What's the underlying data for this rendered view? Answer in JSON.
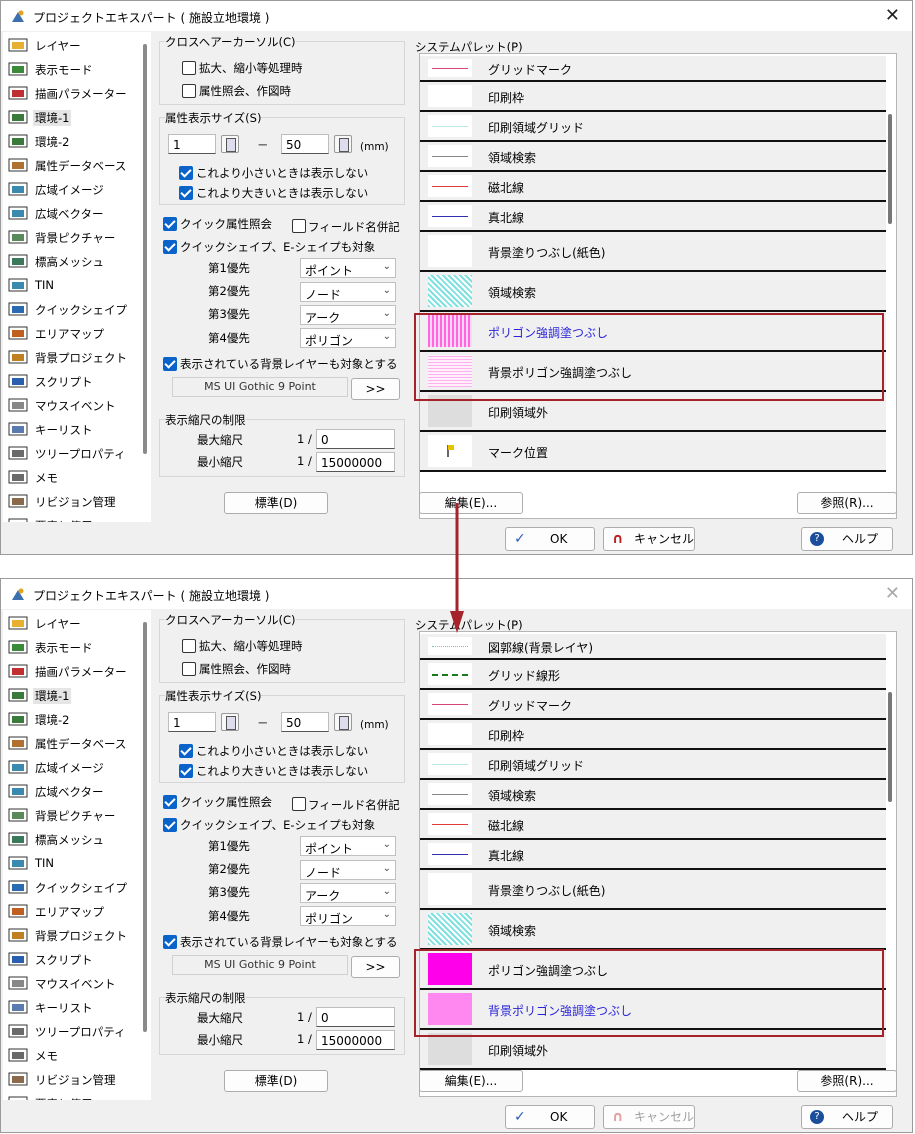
{
  "window": {
    "title": "プロジェクトエキスパート ( 施設立地環境 )",
    "close": "✕"
  },
  "nav_items": [
    "レイヤー",
    "表示モード",
    "描画パラメーター",
    "環境-1",
    "環境-2",
    "属性データベース",
    "広域イメージ",
    "広域ベクター",
    "背景ピクチャー",
    "標高メッシュ",
    "TIN",
    "クイックシェイプ",
    "エリアマップ",
    "背景プロジェクト",
    "スクリプト",
    "マウスイベント",
    "キーリスト",
    "ツリープロパティ",
    "メモ",
    "リビジョン管理",
    "要素と使用"
  ],
  "nav_selected": 3,
  "cross_cursor": {
    "title": "クロスヘアーカーソル(C)",
    "opt1": "拡大、縮小等処理時",
    "opt2": "属性照会、作図時"
  },
  "attr_size": {
    "title": "属性表示サイズ(S)",
    "min": "1",
    "dash": "－",
    "max": "50",
    "unit": "(mm)",
    "small_hide": "これより小さいときは表示しない",
    "large_hide": "これより大きいときは表示しない"
  },
  "quick": {
    "query": "クイック属性照会",
    "field_name": "フィールド名併記",
    "shape": "クイックシェイプ、E-シェイプも対象",
    "priorities": [
      {
        "label": "第1優先",
        "value": "ポイント"
      },
      {
        "label": "第2優先",
        "value": "ノード"
      },
      {
        "label": "第3優先",
        "value": "アーク"
      },
      {
        "label": "第4優先",
        "value": "ポリゴン"
      }
    ],
    "bg_layer": "表示されている背景レイヤーも対象とする",
    "font": "MS UI Gothic 9 Point",
    "font_btn": ">>"
  },
  "scale": {
    "title": "表示縮尺の制限",
    "max_label": "最大縮尺",
    "min_label": "最小縮尺",
    "prefix": "1 /",
    "max_value": "0",
    "min_value": "15000000"
  },
  "standard_btn": "標準(D)",
  "palette": {
    "title": "システムパレット(P)",
    "edit_btn": "編集(E)...",
    "ref_btn": "参照(R)..."
  },
  "palette_rows_1": [
    {
      "label": "グリッドマーク",
      "swatch": "line",
      "color": "#d9457a"
    },
    {
      "label": "印刷枠",
      "swatch": "blank",
      "color": "#ffffff"
    },
    {
      "label": "印刷領域グリッド",
      "swatch": "line",
      "color": "#b9e6e6"
    },
    {
      "label": "領域検索",
      "swatch": "line",
      "color": "#888888"
    },
    {
      "label": "磁北線",
      "swatch": "line",
      "color": "#e03a3a"
    },
    {
      "label": "真北線",
      "swatch": "line",
      "color": "#3030b0"
    },
    {
      "label": "背景塗りつぶし(紙色)",
      "swatch": "blank",
      "color": "#ffffff"
    },
    {
      "label": "領域検索",
      "swatch": "hatch",
      "color": "#7fe0e0"
    },
    {
      "label": "ポリゴン強調塗つぶし",
      "swatch": "stripe",
      "color": "#ff66e0",
      "blue": true
    },
    {
      "label": "背景ポリゴン強調塗つぶし",
      "swatch": "dots",
      "color": "#ffb0f0"
    },
    {
      "label": "印刷領域外",
      "swatch": "gray",
      "color": "#dddddd"
    },
    {
      "label": "マーク位置",
      "swatch": "flag",
      "color": "#e8c400"
    }
  ],
  "palette_rows_2": [
    {
      "label": "図郭線(背景レイヤ)",
      "swatch": "dotline",
      "color": "#6fc6c6"
    },
    {
      "label": "グリッド線形",
      "swatch": "dashline",
      "color": "#1a7a1a"
    },
    {
      "label": "グリッドマーク",
      "swatch": "line",
      "color": "#d9457a"
    },
    {
      "label": "印刷枠",
      "swatch": "blank",
      "color": "#ffffff"
    },
    {
      "label": "印刷領域グリッド",
      "swatch": "line",
      "color": "#b9e6e6"
    },
    {
      "label": "領域検索",
      "swatch": "line",
      "color": "#888888"
    },
    {
      "label": "磁北線",
      "swatch": "line",
      "color": "#e03a3a"
    },
    {
      "label": "真北線",
      "swatch": "line",
      "color": "#3030b0"
    },
    {
      "label": "背景塗りつぶし(紙色)",
      "swatch": "blank",
      "color": "#ffffff"
    },
    {
      "label": "領域検索",
      "swatch": "hatch",
      "color": "#7fe0e0"
    },
    {
      "label": "ポリゴン強調塗つぶし",
      "swatch": "solid",
      "color": "#ff00ea"
    },
    {
      "label": "背景ポリゴン強調塗つぶし",
      "swatch": "solid",
      "color": "#ff88f0",
      "blue": true
    },
    {
      "label": "印刷領域外",
      "swatch": "gray",
      "color": "#dddddd"
    }
  ],
  "buttons": {
    "ok": "OK",
    "cancel": "キャンセル",
    "help": "ヘルプ"
  },
  "colors": {
    "highlight_border": "#a5232b",
    "arrow": "#a5232b",
    "checkbox": "#0a63c9"
  }
}
